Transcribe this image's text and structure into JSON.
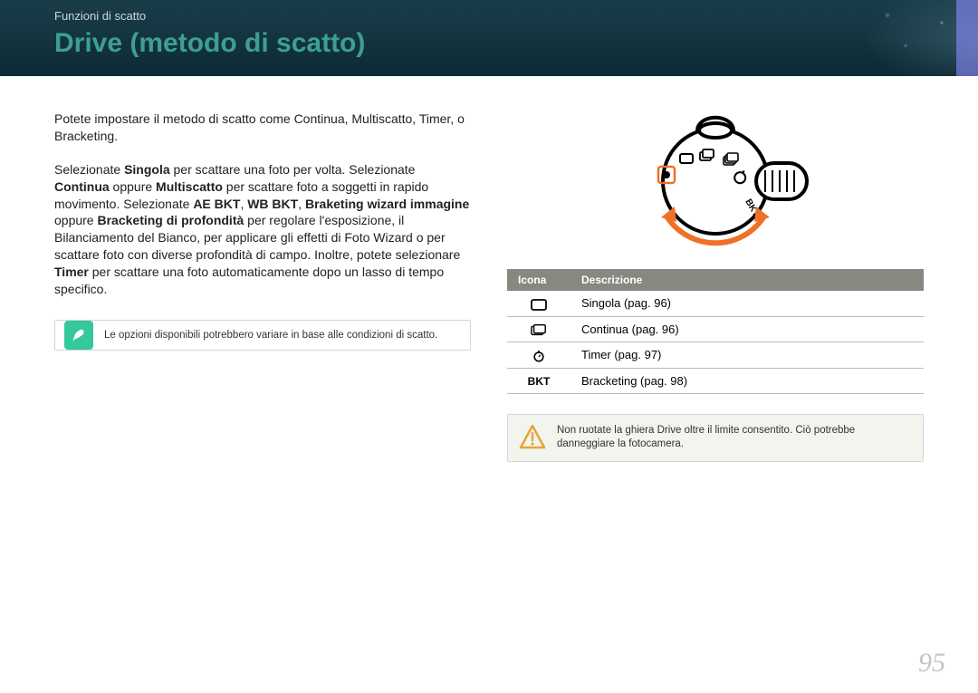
{
  "breadcrumb": "Funzioni di scatto",
  "title": "Drive (metodo di scatto)",
  "intro": "Potete impostare il metodo di scatto come Continua, Multiscatto, Timer, o Bracketing.",
  "body": {
    "pre1": "Selezionate ",
    "b1": "Singola",
    "t1": " per scattare una foto per volta. Selezionate ",
    "b2": "Continua",
    "t2": " oppure ",
    "b3": "Multiscatto",
    "t3": " per scattare foto a soggetti in rapido movimento. Selezionate ",
    "b4": "AE BKT",
    "c1": ", ",
    "b5": "WB BKT",
    "c2": ", ",
    "b6": "Braketing wizard immagine",
    "t4": " oppure ",
    "b7": "Bracketing di profondità",
    "t5": " per regolare l'esposizione, il Bilanciamento del Bianco, per applicare gli effetti di Foto Wizard o per scattare foto con diverse profondità di campo. Inoltre, potete selezionare ",
    "b8": "Timer",
    "t6": " per scattare una foto automaticamente dopo un lasso di tempo specifico."
  },
  "note": "Le opzioni disponibili potrebbero variare in base alle condizioni di scatto.",
  "table": {
    "h1": "Icona",
    "h2": "Descrizione",
    "rows": [
      {
        "icon": "single",
        "desc": "Singola (pag. 96)"
      },
      {
        "icon": "continuous",
        "desc": "Continua (pag. 96)"
      },
      {
        "icon": "timer",
        "desc": "Timer (pag. 97)"
      },
      {
        "icon": "bkt",
        "desc": "Bracketing (pag. 98)"
      }
    ]
  },
  "bkt_label": "BKT",
  "warning": "Non ruotate la ghiera Drive oltre il limite consentito. Ciò potrebbe danneggiare la fotocamera.",
  "page_number": "95"
}
